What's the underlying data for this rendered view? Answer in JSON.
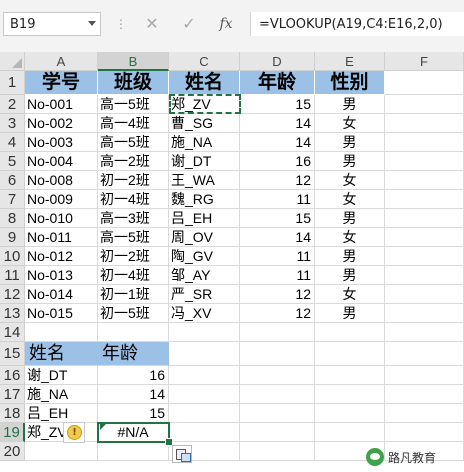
{
  "formula_bar": {
    "name_box": "B19",
    "dots": "⋮",
    "cancel": "✕",
    "enter": "✓",
    "fx": "fx",
    "formula": "=VLOOKUP(A19,C4:E16,2,0)"
  },
  "columns": [
    "A",
    "B",
    "C",
    "D",
    "E",
    "F"
  ],
  "rows": [
    "1",
    "2",
    "3",
    "4",
    "5",
    "6",
    "7",
    "8",
    "9",
    "10",
    "11",
    "12",
    "13",
    "14",
    "15",
    "16",
    "17",
    "18",
    "19",
    "20"
  ],
  "table": {
    "headers": [
      "学号",
      "班级",
      "姓名",
      "年龄",
      "性别"
    ],
    "rows": [
      [
        "No-001",
        "高一5班",
        "郑_ZV",
        "15",
        "男"
      ],
      [
        "No-002",
        "高一4班",
        "曹_SG",
        "14",
        "女"
      ],
      [
        "No-003",
        "高一5班",
        "施_NA",
        "14",
        "男"
      ],
      [
        "No-004",
        "高一2班",
        "谢_DT",
        "16",
        "男"
      ],
      [
        "No-008",
        "初一2班",
        "王_WA",
        "12",
        "女"
      ],
      [
        "No-009",
        "初一4班",
        "魏_RG",
        "11",
        "女"
      ],
      [
        "No-010",
        "高一3班",
        "吕_EH",
        "15",
        "男"
      ],
      [
        "No-011",
        "高一5班",
        "周_OV",
        "14",
        "女"
      ],
      [
        "No-012",
        "初一2班",
        "陶_GV",
        "11",
        "男"
      ],
      [
        "No-013",
        "初一4班",
        "邹_AY",
        "11",
        "男"
      ],
      [
        "No-014",
        "初一1班",
        "严_SR",
        "12",
        "女"
      ],
      [
        "No-015",
        "初一5班",
        "冯_XV",
        "12",
        "男"
      ]
    ]
  },
  "lookup": {
    "headers": [
      "姓名",
      "年龄"
    ],
    "rows": [
      [
        "谢_DT",
        "16"
      ],
      [
        "施_NA",
        "14"
      ],
      [
        "吕_EH",
        "15"
      ],
      [
        "郑_ZV",
        "#N/A"
      ]
    ]
  },
  "error_icon": "!",
  "watermark": {
    "icon": "wechat-icon",
    "text": "路凡教育"
  },
  "colors": {
    "header_fill": "#9bc2e6",
    "selection_green": "#217346",
    "grid": "#dadada"
  }
}
